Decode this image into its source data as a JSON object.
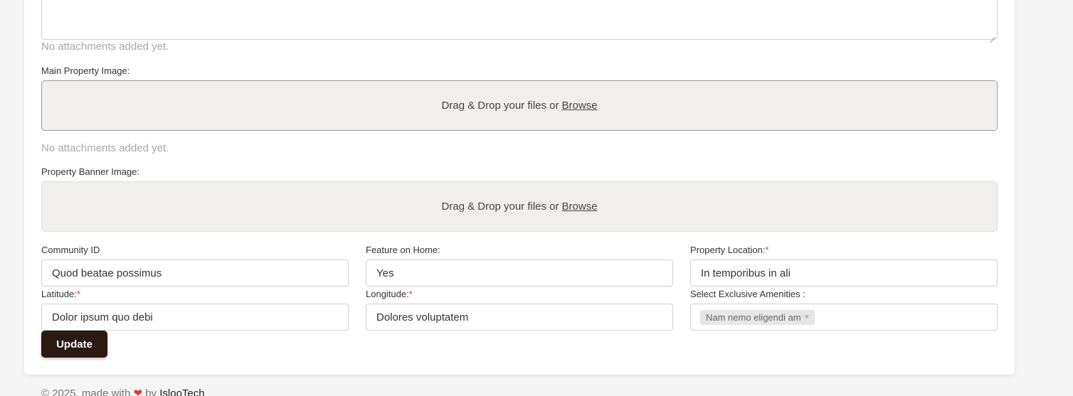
{
  "form": {
    "attachments_note_1": "No attachments added yet.",
    "main_image": {
      "label": "Main Property Image:",
      "drop_text": "Drag & Drop your files or",
      "browse": "Browse"
    },
    "attachments_note_2": "No attachments added yet.",
    "banner_image": {
      "label": "Property Banner Image:",
      "drop_text": "Drag & Drop your files or",
      "browse": "Browse"
    },
    "community_id": {
      "label": "Community ID",
      "value": "Quod beatae possimus"
    },
    "feature_on_home": {
      "label": "Feature on Home:",
      "value": "Yes"
    },
    "property_location": {
      "label": "Property Location:",
      "required": "*",
      "value": "In temporibus in ali"
    },
    "latitude": {
      "label": "Latitude:",
      "required": "*",
      "value": "Dolor ipsum quo debi"
    },
    "longitude": {
      "label": "Longitude:",
      "required": "*",
      "value": "Dolores voluptatem"
    },
    "amenities": {
      "label": "Select Exclusive Amenities :",
      "selected": [
        "Nam nemo eligendi am"
      ],
      "remove_glyph": "×"
    },
    "update_label": "Update"
  },
  "footer": {
    "prefix": "© 2025, made with",
    "heart": "❤",
    "by": "by",
    "company": "IslooTech"
  },
  "colors": {
    "primary_button": "#2a1a12",
    "required": "#e53935",
    "dropzone_bg": "#f0efed"
  }
}
